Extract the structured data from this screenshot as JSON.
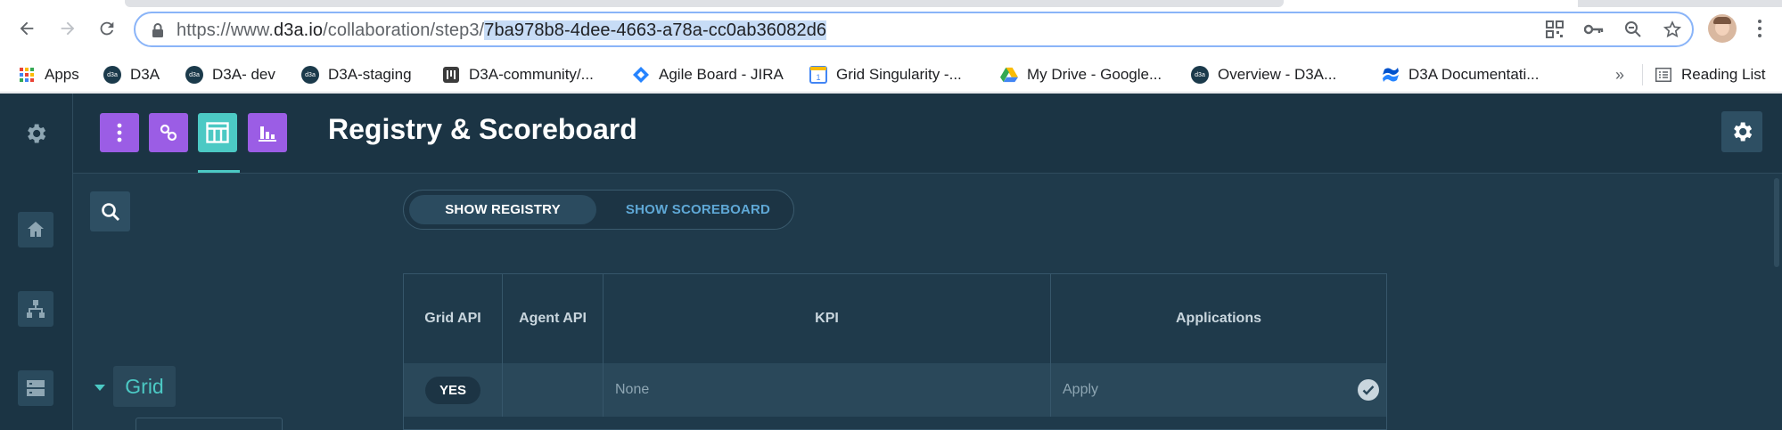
{
  "browser": {
    "url_prefix": "https://www.",
    "url_host": "d3a.io",
    "url_path": "/collaboration/step3/",
    "url_selected": "7ba978b8-4dee-4663-a78a-cc0ab36082d6"
  },
  "bookmarks": [
    {
      "label": "Apps",
      "icon": "apps-grid-icon"
    },
    {
      "label": "D3A",
      "icon": "d3a-favicon-icon"
    },
    {
      "label": "D3A- dev",
      "icon": "d3a-favicon-icon"
    },
    {
      "label": "D3A-staging",
      "icon": "d3a-favicon-icon"
    },
    {
      "label": "D3A-community/...",
      "icon": "github-favicon-icon"
    },
    {
      "label": "Agile Board - JIRA",
      "icon": "jira-favicon-icon"
    },
    {
      "label": "Grid Singularity -...",
      "icon": "calendar-favicon-icon"
    },
    {
      "label": "My Drive - Google...",
      "icon": "google-drive-icon"
    },
    {
      "label": "Overview - D3A...",
      "icon": "d3a-favicon-icon"
    },
    {
      "label": "D3A Documentati...",
      "icon": "confluence-favicon-icon"
    }
  ],
  "bookmarks_overflow": "»",
  "reading_list": "Reading List",
  "app": {
    "title": "Registry & Scoreboard",
    "toggle": {
      "registry": "SHOW REGISTRY",
      "scoreboard": "SHOW SCOREBOARD"
    },
    "table": {
      "headers": [
        "Grid API",
        "Agent API",
        "KPI",
        "Applications"
      ],
      "rows": [
        {
          "grid_api": "YES",
          "agent_api": "",
          "kpi": "None",
          "applications": "Apply"
        }
      ]
    },
    "tree": {
      "root_label": "Grid"
    },
    "colors": {
      "accent_teal": "#4cc9c4",
      "accent_purple": "#9b5de5",
      "bg_dark": "#1f3a4b",
      "link_blue": "#5fa8d6"
    }
  }
}
